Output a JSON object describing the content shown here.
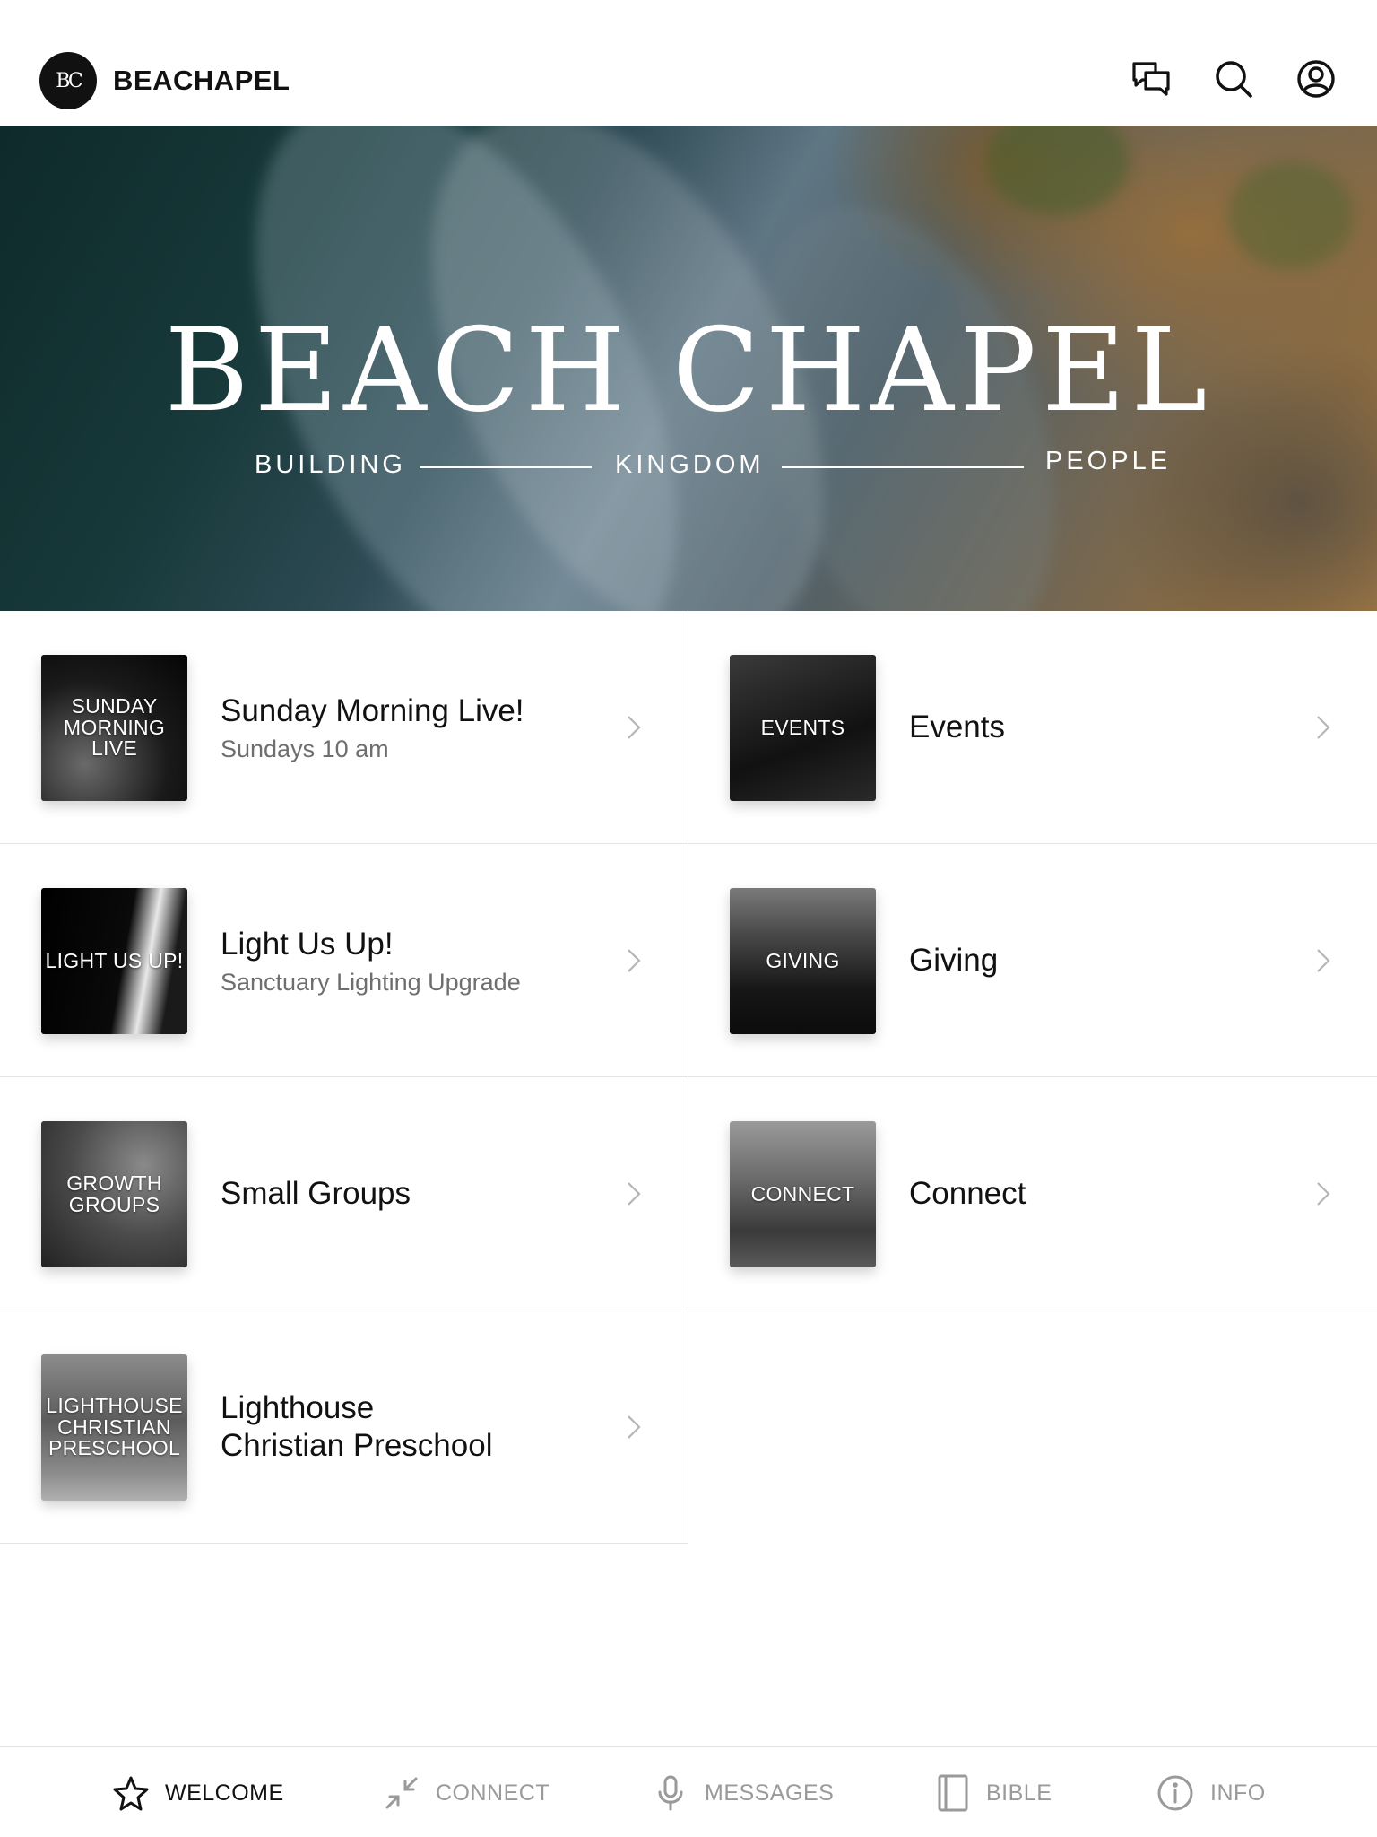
{
  "header": {
    "logo_text": "BC",
    "app_name": "BEACHAPEL",
    "icons": [
      "chat-icon",
      "search-icon",
      "profile-icon"
    ]
  },
  "hero": {
    "title": "BEACH CHAPEL",
    "tagline": [
      "BUILDING",
      "KINGDOM",
      "PEOPLE"
    ]
  },
  "cards": [
    {
      "thumb_label": "SUNDAY\nMORNING\nLIVE",
      "title": "Sunday Morning Live!",
      "subtitle": "Sundays 10 am"
    },
    {
      "thumb_label": "EVENTS",
      "title": "Events",
      "subtitle": ""
    },
    {
      "thumb_label": "LIGHT US UP!",
      "title": "Light Us Up!",
      "subtitle": "Sanctuary Lighting Upgrade"
    },
    {
      "thumb_label": "GIVING",
      "title": "Giving",
      "subtitle": ""
    },
    {
      "thumb_label": "GROWTH\nGROUPS",
      "title": "Small Groups",
      "subtitle": ""
    },
    {
      "thumb_label": "CONNECT",
      "title": "Connect",
      "subtitle": ""
    },
    {
      "thumb_label": "LIGHTHOUSE\nCHRISTIAN\nPRESCHOOL",
      "title": "Lighthouse\nChristian Preschool",
      "subtitle": ""
    }
  ],
  "tabs": [
    {
      "label": "WELCOME",
      "icon": "star-icon",
      "active": true
    },
    {
      "label": "CONNECT",
      "icon": "arrows-in-icon",
      "active": false
    },
    {
      "label": "MESSAGES",
      "icon": "microphone-icon",
      "active": false
    },
    {
      "label": "BIBLE",
      "icon": "book-icon",
      "active": false
    },
    {
      "label": "INFO",
      "icon": "info-icon",
      "active": false
    }
  ],
  "colors": {
    "text": "#111111",
    "muted": "#6e6e6e",
    "inactive_tab": "#9a9a9a",
    "divider": "#e4e4e4"
  }
}
